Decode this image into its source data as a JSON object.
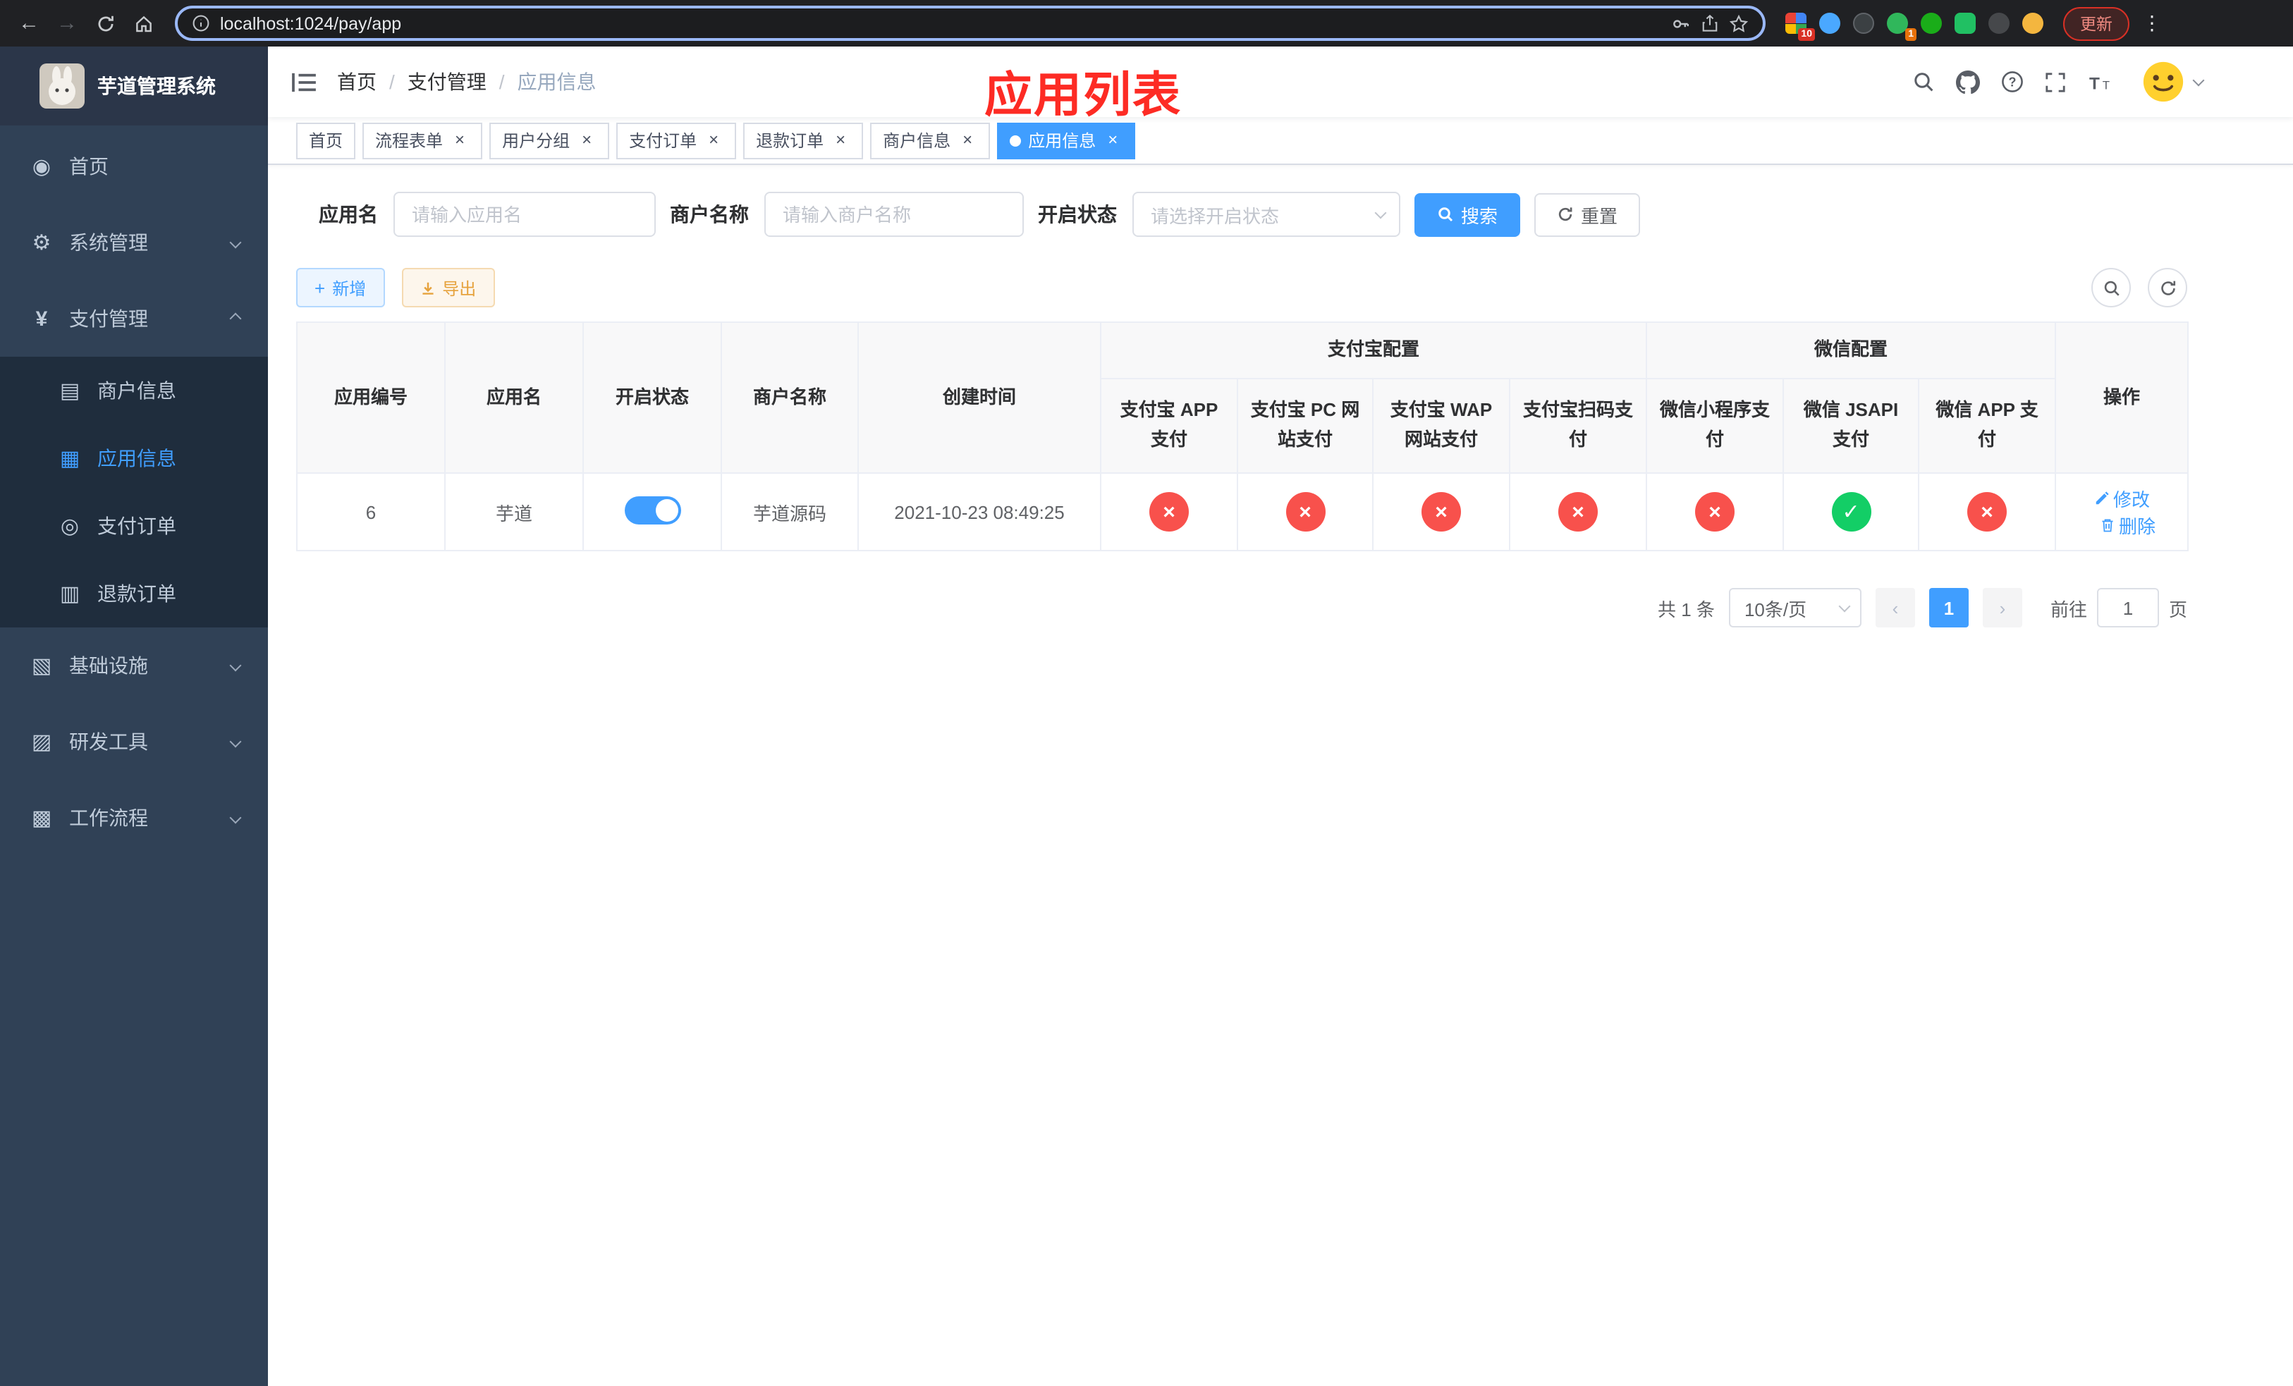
{
  "browser": {
    "url": "localhost:1024/pay/app",
    "update_label": "更新",
    "ext_badge_grid": "10",
    "ext_badge_green": "1"
  },
  "sidebar": {
    "title": "芋道管理系统",
    "menu": {
      "home": "首页",
      "system": "系统管理",
      "payment": "支付管理",
      "merchant_info": "商户信息",
      "app_info": "应用信息",
      "pay_order": "支付订单",
      "refund_order": "退款订单",
      "infra": "基础设施",
      "dev_tools": "研发工具",
      "workflow": "工作流程"
    }
  },
  "navbar": {
    "breadcrumb": [
      "首页",
      "支付管理",
      "应用信息"
    ]
  },
  "annotation": "应用列表",
  "tabs": [
    {
      "label": "首页"
    },
    {
      "label": "流程表单"
    },
    {
      "label": "用户分组"
    },
    {
      "label": "支付订单"
    },
    {
      "label": "退款订单"
    },
    {
      "label": "商户信息"
    },
    {
      "label": "应用信息"
    }
  ],
  "filters": {
    "app_name_label": "应用名",
    "app_name_placeholder": "请输入应用名",
    "merchant_label": "商户名称",
    "merchant_placeholder": "请输入商户名称",
    "status_label": "开启状态",
    "status_placeholder": "请选择开启状态",
    "search_button": "搜索",
    "reset_button": "重置"
  },
  "toolbar": {
    "add_button": "新增",
    "export_button": "导出"
  },
  "table": {
    "groups": {
      "alipay": "支付宝配置",
      "wechat": "微信配置"
    },
    "columns": {
      "id": "应用编号",
      "name": "应用名",
      "status": "开启状态",
      "merchant": "商户名称",
      "created": "创建时间",
      "alipay_app": "支付宝 APP 支付",
      "alipay_pc": "支付宝 PC 网站支付",
      "alipay_wap": "支付宝 WAP 网站支付",
      "alipay_qr": "支付宝扫码支付",
      "wx_mini": "微信小程序支付",
      "wx_jsapi": "微信 JSAPI 支付",
      "wx_app": "微信 APP 支付",
      "actions": "操作"
    },
    "row": {
      "id": "6",
      "name": "芋道",
      "status_on": true,
      "merchant": "芋道源码",
      "created": "2021-10-23 08:49:25",
      "alipay_app": false,
      "alipay_pc": false,
      "alipay_wap": false,
      "alipay_qr": false,
      "wx_mini": false,
      "wx_jsapi": true,
      "wx_app": false,
      "edit_label": "修改",
      "delete_label": "删除"
    }
  },
  "pagination": {
    "total": "共 1 条",
    "page_size": "10条/页",
    "page": "1",
    "goto_label": "前往",
    "goto_value": "1",
    "unit_label": "页"
  },
  "colors": {
    "primary": "#409eff",
    "success": "#13ce66",
    "danger": "#f8514c",
    "warning": "#e6a23c",
    "sidebar_bg": "#304156",
    "submenu_bg": "#1f2d3d",
    "annotation_red": "#fd2b24"
  }
}
